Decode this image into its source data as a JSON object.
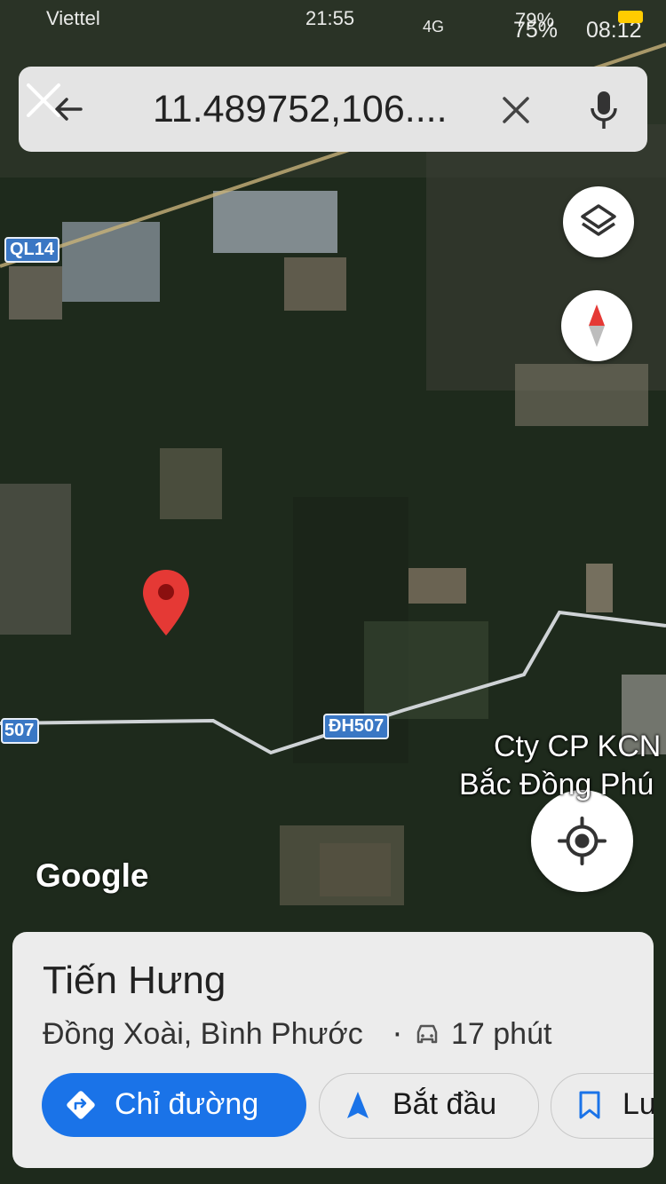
{
  "status_bar": {
    "carrier": "Viettel",
    "time": "21:55",
    "battery_top": "79%",
    "battery_bottom": "75%",
    "time_secondary": "08:12",
    "network": "4G"
  },
  "search": {
    "query": "11.489752,106...."
  },
  "map": {
    "roads": [
      "QL14",
      "507",
      "ĐH507"
    ],
    "label_line1": "Cty CP KCN",
    "label_line2": "Bắc Đồng Phú",
    "logo": "Google",
    "pin_color": "#e53935"
  },
  "place": {
    "name": "Tiến Hưng",
    "subtitle": "Đồng Xoài, Bình Phước",
    "separator": "·",
    "eta": "17 phút"
  },
  "actions": {
    "directions": "Chỉ đường",
    "start": "Bắt đầu",
    "save": "Lưu"
  },
  "colors": {
    "accent": "#1a73e8",
    "sheet": "#ececec"
  }
}
